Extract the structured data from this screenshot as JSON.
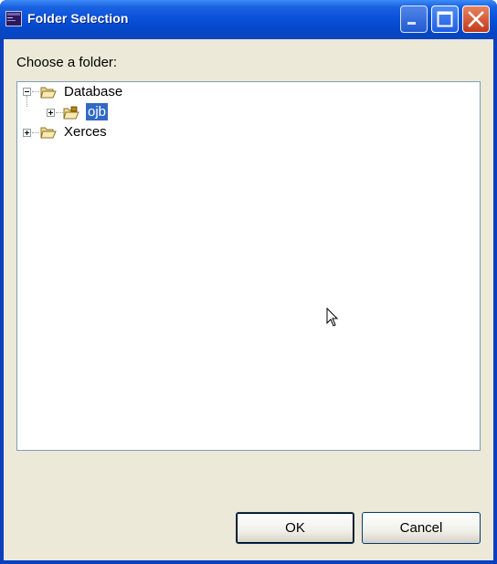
{
  "window": {
    "title": "Folder Selection",
    "colors": {
      "titlebar": "#0a52db",
      "client": "#ece9d8",
      "selection": "#316ac5"
    }
  },
  "dialog": {
    "prompt": "Choose a folder:"
  },
  "tree": {
    "nodes": [
      {
        "label": "Database",
        "expanded": true,
        "icon": "open-folder-icon"
      },
      {
        "label": "ojb",
        "expanded": false,
        "selected": true,
        "icon": "project-folder-icon"
      },
      {
        "label": "Xerces",
        "expanded": false,
        "icon": "open-folder-icon"
      }
    ]
  },
  "buttons": {
    "ok": "OK",
    "cancel": "Cancel"
  }
}
